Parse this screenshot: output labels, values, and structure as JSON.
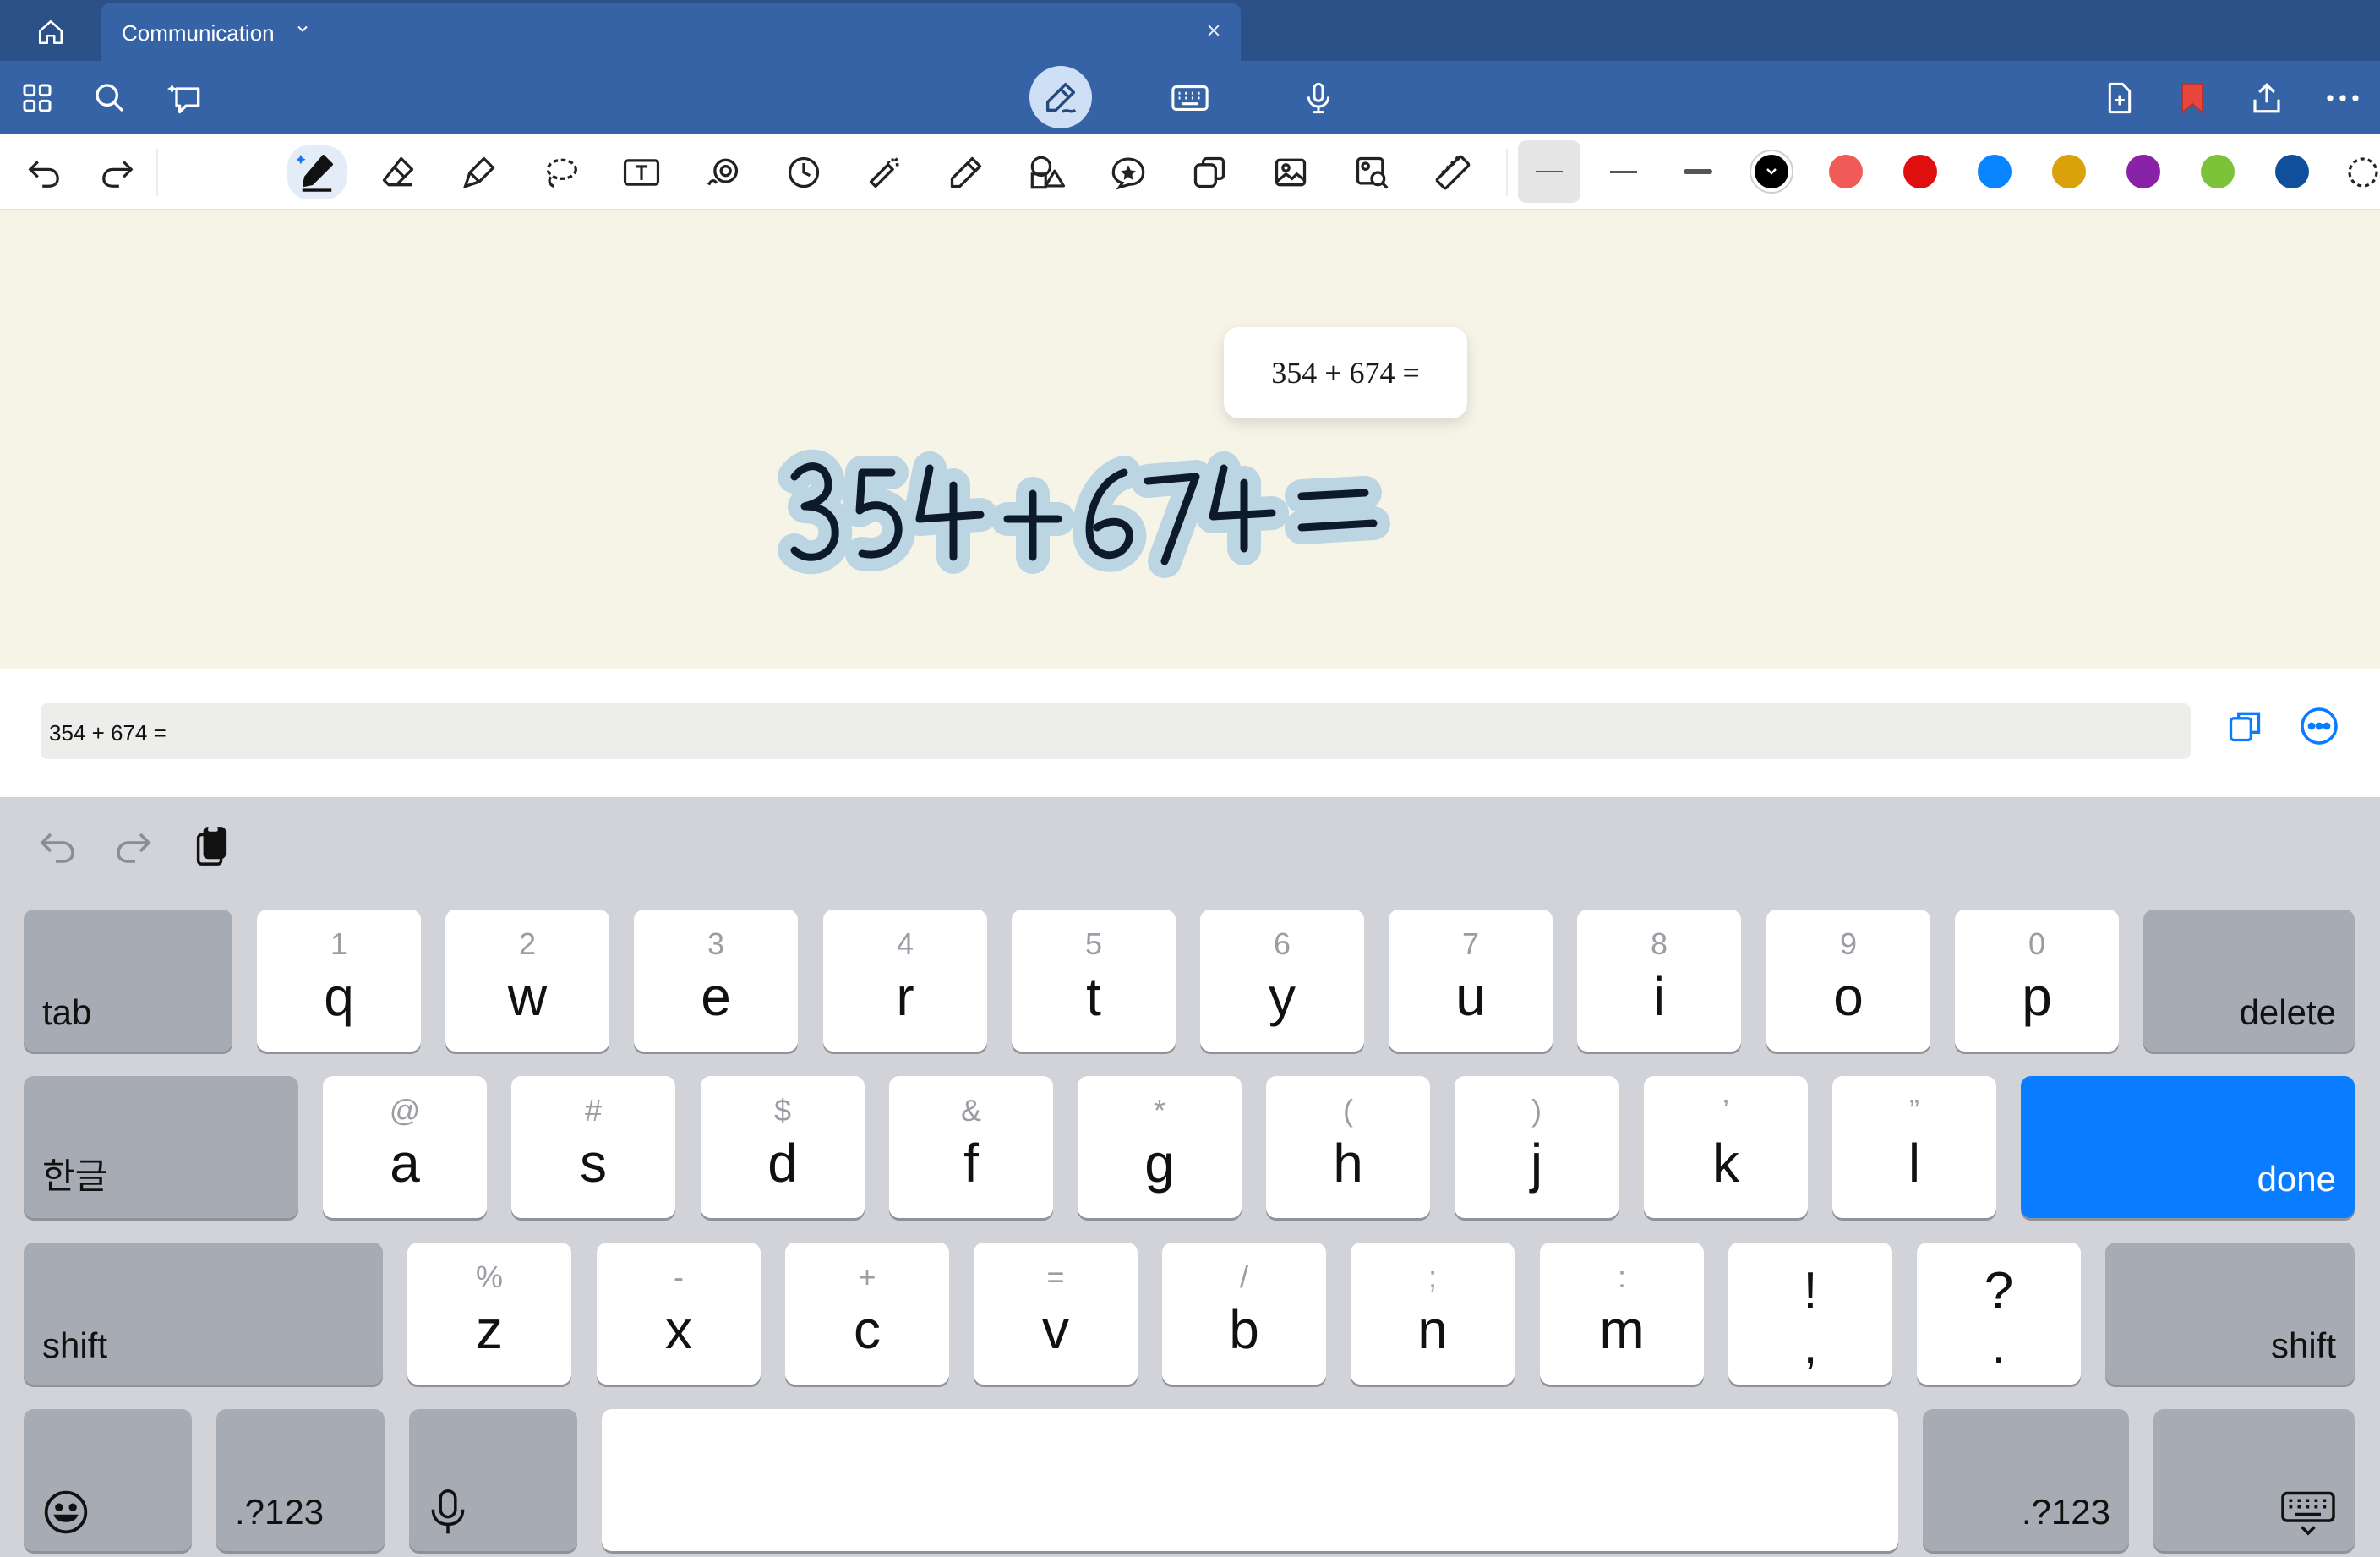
{
  "tabstrip": {
    "tab_title": "Communication"
  },
  "header": {
    "icons": [
      "grid-icon",
      "search-icon",
      "ai-assist-icon",
      "pen-mode-icon",
      "keyboard-mode-icon",
      "microphone-icon",
      "add-page-icon",
      "bookmark-icon",
      "share-icon",
      "more-icon"
    ]
  },
  "tools": {
    "items": [
      "undo",
      "redo",
      "pen",
      "eraser",
      "highlighter",
      "lasso",
      "text",
      "audio",
      "clock",
      "laser-pointer",
      "pencil",
      "shapes",
      "sticker",
      "copy-element",
      "image",
      "image-search",
      "ruler"
    ],
    "colors": [
      "#000000",
      "#f05a57",
      "#e00f0f",
      "#0a84ff",
      "#d9a20b",
      "#8a22a8",
      "#7cc33a",
      "#0f4f9c"
    ],
    "selected_color": "#000000",
    "bookmark_color": "#e8453c"
  },
  "canvas": {
    "popup_expression": "354 + 674 =",
    "handwriting": "354 + 674 ="
  },
  "recognition": {
    "text": "354 + 674 ="
  },
  "keyboard": {
    "row1": [
      {
        "alt": "1",
        "main": "q"
      },
      {
        "alt": "2",
        "main": "w"
      },
      {
        "alt": "3",
        "main": "e"
      },
      {
        "alt": "4",
        "main": "r"
      },
      {
        "alt": "5",
        "main": "t"
      },
      {
        "alt": "6",
        "main": "y"
      },
      {
        "alt": "7",
        "main": "u"
      },
      {
        "alt": "8",
        "main": "i"
      },
      {
        "alt": "9",
        "main": "o"
      },
      {
        "alt": "0",
        "main": "p"
      }
    ],
    "row2": [
      {
        "alt": "@",
        "main": "a"
      },
      {
        "alt": "#",
        "main": "s"
      },
      {
        "alt": "$",
        "main": "d"
      },
      {
        "alt": "&",
        "main": "f"
      },
      {
        "alt": "*",
        "main": "g"
      },
      {
        "alt": "(",
        "main": "h"
      },
      {
        "alt": ")",
        "main": "j"
      },
      {
        "alt": "’",
        "main": "k"
      },
      {
        "alt": "”",
        "main": "l"
      }
    ],
    "row3": [
      {
        "alt": "%",
        "main": "z"
      },
      {
        "alt": "-",
        "main": "x"
      },
      {
        "alt": "+",
        "main": "c"
      },
      {
        "alt": "=",
        "main": "v"
      },
      {
        "alt": "/",
        "main": "b"
      },
      {
        "alt": ";",
        "main": "n"
      },
      {
        "alt": ":",
        "main": "m"
      }
    ],
    "punct": [
      {
        "top": "!",
        "bottom": ","
      },
      {
        "top": "?",
        "bottom": "."
      }
    ],
    "tab_label": "tab",
    "delete_label": "delete",
    "lang_label": "한글",
    "done_label": "done",
    "shift_label": "shift",
    "numbers_label": ".?123"
  }
}
